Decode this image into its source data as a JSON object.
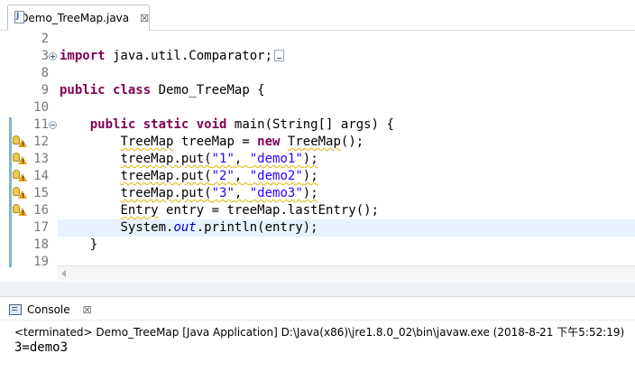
{
  "editor_tab": {
    "title": "Demo_TreeMap.java",
    "close": "☒"
  },
  "lines": [
    {
      "no": "2"
    },
    {
      "no": "3"
    },
    {
      "no": "8"
    },
    {
      "no": "9"
    },
    {
      "no": "10"
    },
    {
      "no": "11"
    },
    {
      "no": "12"
    },
    {
      "no": "13"
    },
    {
      "no": "14"
    },
    {
      "no": "15"
    },
    {
      "no": "16"
    },
    {
      "no": "17"
    },
    {
      "no": "18"
    },
    {
      "no": "19"
    }
  ],
  "code": {
    "l3": {
      "kw": "import",
      "text": " java.util.Comparator;"
    },
    "l9": {
      "kw1": "public",
      "kw2": "class",
      "text": " Demo_TreeMap {"
    },
    "l11": {
      "indent": "    ",
      "kw1": "public",
      "kw2": "static",
      "kw3": "void",
      "text": " main(String[] args) {"
    },
    "l12": {
      "indent": "        ",
      "a": "TreeMap",
      "b": " treeMap = ",
      "kw": "new",
      "c": " ",
      "d": "TreeMap",
      "e": "();"
    },
    "l13": {
      "indent": "        ",
      "a": "treeMap.put(",
      "s1": "\"1\"",
      "comma": ", ",
      "s2": "\"demo1\"",
      "end": ");"
    },
    "l14": {
      "indent": "        ",
      "a": "treeMap.put(",
      "s1": "\"2\"",
      "comma": ", ",
      "s2": "\"demo2\"",
      "end": ");"
    },
    "l15": {
      "indent": "        ",
      "a": "treeMap.put(",
      "s1": "\"3\"",
      "comma": ", ",
      "s2": "\"demo3\"",
      "end": ");"
    },
    "l16": {
      "indent": "        ",
      "a": "Entry",
      "b": " entry = treeMap.lastEntry();"
    },
    "l17": {
      "indent": "        ",
      "a": "System.",
      "field": "out",
      "b": ".println(entry);"
    },
    "l18": {
      "indent": "    ",
      "text": "}"
    }
  },
  "console": {
    "tab_label": "Console",
    "close": "☒",
    "status": "<terminated> Demo_TreeMap [Java Application] D:\\Java(x86)\\jre1.8.0_02\\bin\\javaw.exe (2018-8-21 下午5:52:19)",
    "output": "3=demo3"
  },
  "colors": {
    "keyword": "#7f0055",
    "string": "#2a00ff",
    "field": "#0000c0",
    "current_line": "#e8f2fe",
    "gutter_band": "#7fb8c9"
  }
}
